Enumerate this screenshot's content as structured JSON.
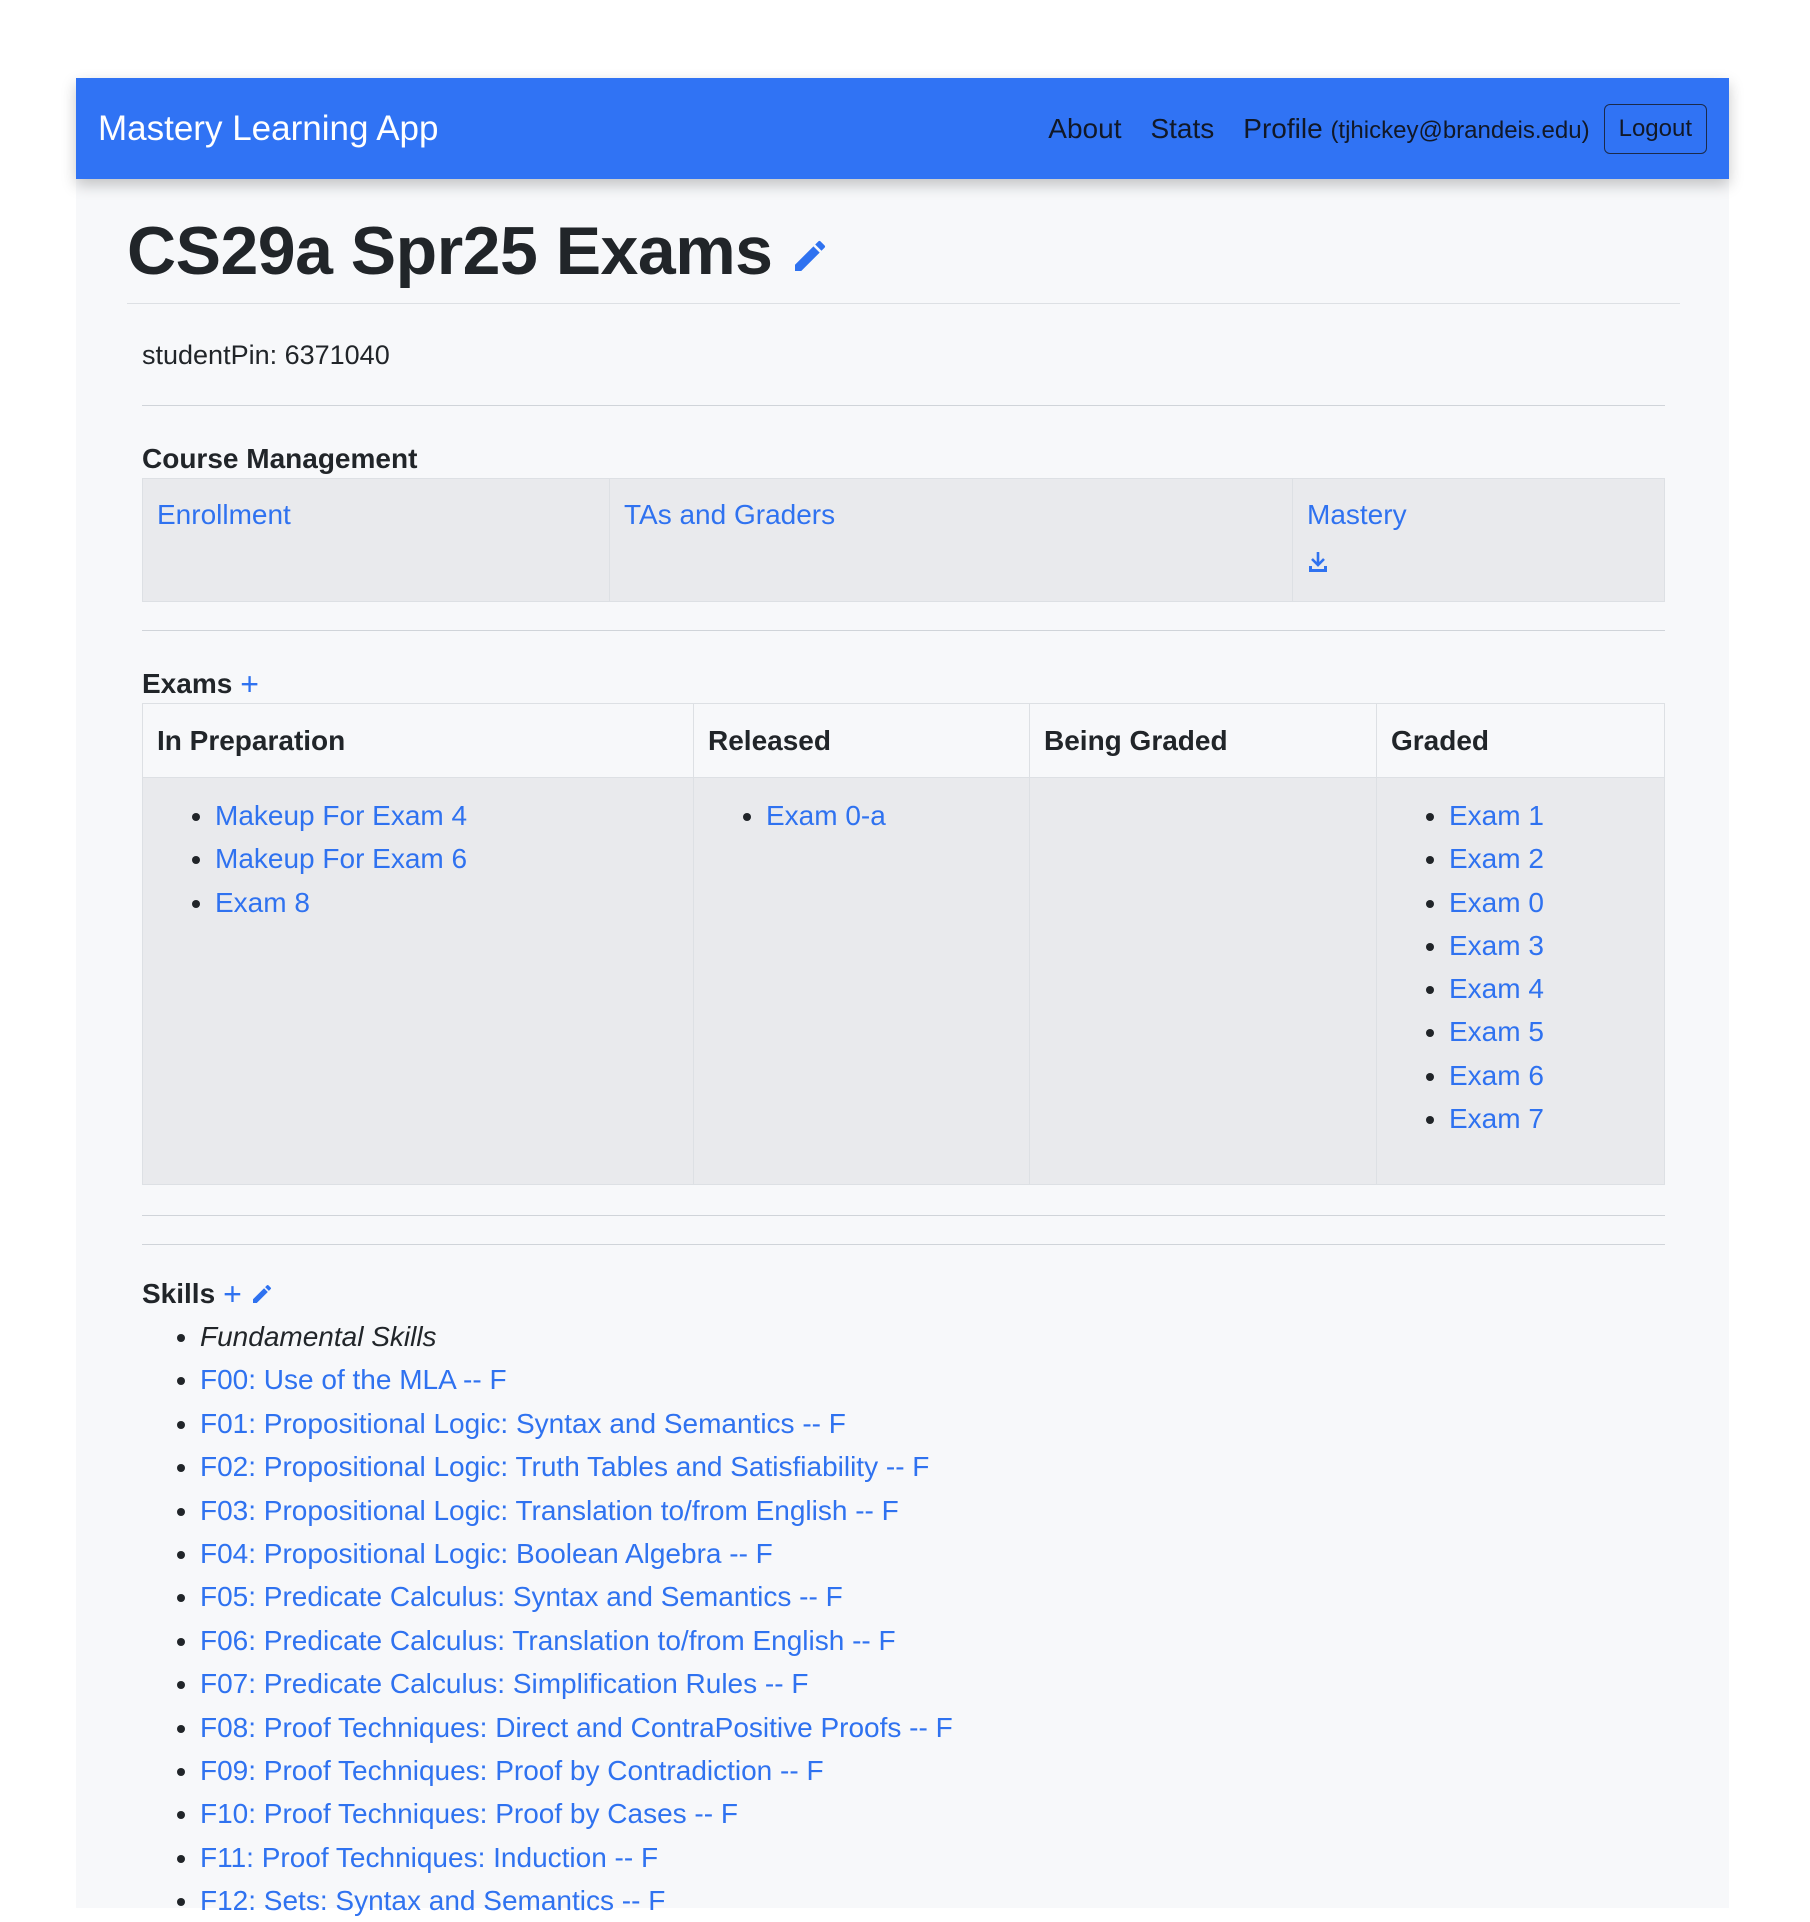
{
  "navbar": {
    "brand": "Mastery Learning App",
    "about": "About",
    "stats": "Stats",
    "profile": "Profile",
    "email": "(tjhickey@brandeis.edu)",
    "logout": "Logout"
  },
  "page": {
    "title": "CS29a Spr25 Exams",
    "student_pin": "studentPin: 6371040"
  },
  "course_management": {
    "title": "Course Management",
    "enrollment": "Enrollment",
    "tas": "TAs and Graders",
    "mastery": "Mastery"
  },
  "exams": {
    "title": "Exams",
    "plus": "+",
    "columns": [
      "In Preparation",
      "Released",
      "Being Graded",
      "Graded"
    ],
    "in_preparation": [
      "Makeup For Exam 4",
      "Makeup For Exam 6",
      "Exam 8"
    ],
    "released": [
      "Exam 0-a"
    ],
    "being_graded": [],
    "graded": [
      "Exam 1",
      "Exam 2",
      "Exam 0",
      "Exam 3",
      "Exam 4",
      "Exam 5",
      "Exam 6",
      "Exam 7"
    ]
  },
  "skills": {
    "title": "Skills",
    "plus": "+",
    "items": [
      "Fundamental Skills",
      "F00: Use of the MLA -- F",
      "F01: Propositional Logic: Syntax and Semantics -- F",
      "F02: Propositional Logic: Truth Tables and Satisfiability -- F",
      "F03: Propositional Logic: Translation to/from English -- F",
      "F04: Propositional Logic: Boolean Algebra -- F",
      "F05: Predicate Calculus: Syntax and Semantics -- F",
      "F06: Predicate Calculus: Translation to/from English -- F",
      "F07: Predicate Calculus: Simplification Rules -- F",
      "F08: Proof Techniques: Direct and ContraPositive Proofs -- F",
      "F09: Proof Techniques: Proof by Contradiction -- F",
      "F10: Proof Techniques: Proof by Cases -- F",
      "F11: Proof Techniques: Induction -- F",
      "F12: Sets: Syntax and Semantics -- F"
    ]
  },
  "colors": {
    "navbar": "#3073f4",
    "link": "#2f72f0",
    "cell_bg": "#e9eaed",
    "page_bg": "#f7f8fa"
  }
}
